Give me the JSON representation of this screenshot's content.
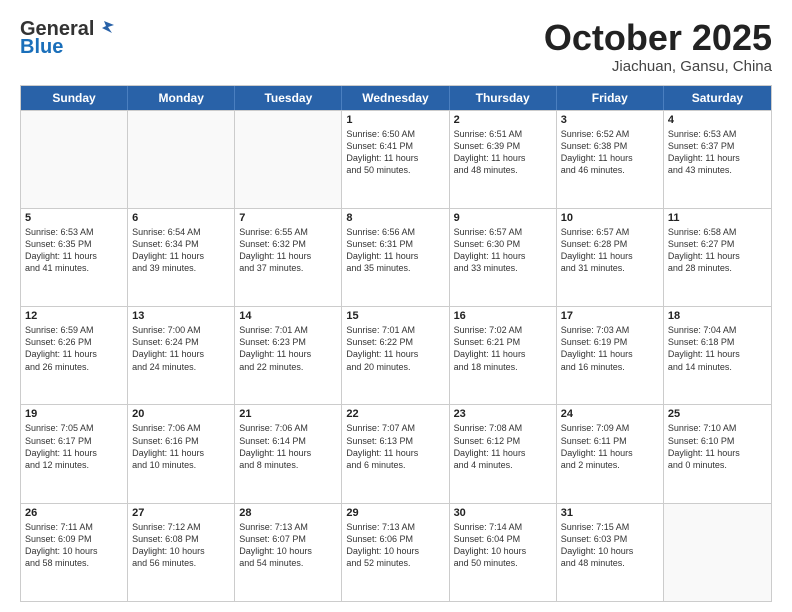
{
  "header": {
    "logo_general": "General",
    "logo_blue": "Blue",
    "month_title": "October 2025",
    "location": "Jiachuan, Gansu, China"
  },
  "weekdays": [
    "Sunday",
    "Monday",
    "Tuesday",
    "Wednesday",
    "Thursday",
    "Friday",
    "Saturday"
  ],
  "weeks": [
    [
      {
        "day": "",
        "info": ""
      },
      {
        "day": "",
        "info": ""
      },
      {
        "day": "",
        "info": ""
      },
      {
        "day": "1",
        "info": "Sunrise: 6:50 AM\nSunset: 6:41 PM\nDaylight: 11 hours\nand 50 minutes."
      },
      {
        "day": "2",
        "info": "Sunrise: 6:51 AM\nSunset: 6:39 PM\nDaylight: 11 hours\nand 48 minutes."
      },
      {
        "day": "3",
        "info": "Sunrise: 6:52 AM\nSunset: 6:38 PM\nDaylight: 11 hours\nand 46 minutes."
      },
      {
        "day": "4",
        "info": "Sunrise: 6:53 AM\nSunset: 6:37 PM\nDaylight: 11 hours\nand 43 minutes."
      }
    ],
    [
      {
        "day": "5",
        "info": "Sunrise: 6:53 AM\nSunset: 6:35 PM\nDaylight: 11 hours\nand 41 minutes."
      },
      {
        "day": "6",
        "info": "Sunrise: 6:54 AM\nSunset: 6:34 PM\nDaylight: 11 hours\nand 39 minutes."
      },
      {
        "day": "7",
        "info": "Sunrise: 6:55 AM\nSunset: 6:32 PM\nDaylight: 11 hours\nand 37 minutes."
      },
      {
        "day": "8",
        "info": "Sunrise: 6:56 AM\nSunset: 6:31 PM\nDaylight: 11 hours\nand 35 minutes."
      },
      {
        "day": "9",
        "info": "Sunrise: 6:57 AM\nSunset: 6:30 PM\nDaylight: 11 hours\nand 33 minutes."
      },
      {
        "day": "10",
        "info": "Sunrise: 6:57 AM\nSunset: 6:28 PM\nDaylight: 11 hours\nand 31 minutes."
      },
      {
        "day": "11",
        "info": "Sunrise: 6:58 AM\nSunset: 6:27 PM\nDaylight: 11 hours\nand 28 minutes."
      }
    ],
    [
      {
        "day": "12",
        "info": "Sunrise: 6:59 AM\nSunset: 6:26 PM\nDaylight: 11 hours\nand 26 minutes."
      },
      {
        "day": "13",
        "info": "Sunrise: 7:00 AM\nSunset: 6:24 PM\nDaylight: 11 hours\nand 24 minutes."
      },
      {
        "day": "14",
        "info": "Sunrise: 7:01 AM\nSunset: 6:23 PM\nDaylight: 11 hours\nand 22 minutes."
      },
      {
        "day": "15",
        "info": "Sunrise: 7:01 AM\nSunset: 6:22 PM\nDaylight: 11 hours\nand 20 minutes."
      },
      {
        "day": "16",
        "info": "Sunrise: 7:02 AM\nSunset: 6:21 PM\nDaylight: 11 hours\nand 18 minutes."
      },
      {
        "day": "17",
        "info": "Sunrise: 7:03 AM\nSunset: 6:19 PM\nDaylight: 11 hours\nand 16 minutes."
      },
      {
        "day": "18",
        "info": "Sunrise: 7:04 AM\nSunset: 6:18 PM\nDaylight: 11 hours\nand 14 minutes."
      }
    ],
    [
      {
        "day": "19",
        "info": "Sunrise: 7:05 AM\nSunset: 6:17 PM\nDaylight: 11 hours\nand 12 minutes."
      },
      {
        "day": "20",
        "info": "Sunrise: 7:06 AM\nSunset: 6:16 PM\nDaylight: 11 hours\nand 10 minutes."
      },
      {
        "day": "21",
        "info": "Sunrise: 7:06 AM\nSunset: 6:14 PM\nDaylight: 11 hours\nand 8 minutes."
      },
      {
        "day": "22",
        "info": "Sunrise: 7:07 AM\nSunset: 6:13 PM\nDaylight: 11 hours\nand 6 minutes."
      },
      {
        "day": "23",
        "info": "Sunrise: 7:08 AM\nSunset: 6:12 PM\nDaylight: 11 hours\nand 4 minutes."
      },
      {
        "day": "24",
        "info": "Sunrise: 7:09 AM\nSunset: 6:11 PM\nDaylight: 11 hours\nand 2 minutes."
      },
      {
        "day": "25",
        "info": "Sunrise: 7:10 AM\nSunset: 6:10 PM\nDaylight: 11 hours\nand 0 minutes."
      }
    ],
    [
      {
        "day": "26",
        "info": "Sunrise: 7:11 AM\nSunset: 6:09 PM\nDaylight: 10 hours\nand 58 minutes."
      },
      {
        "day": "27",
        "info": "Sunrise: 7:12 AM\nSunset: 6:08 PM\nDaylight: 10 hours\nand 56 minutes."
      },
      {
        "day": "28",
        "info": "Sunrise: 7:13 AM\nSunset: 6:07 PM\nDaylight: 10 hours\nand 54 minutes."
      },
      {
        "day": "29",
        "info": "Sunrise: 7:13 AM\nSunset: 6:06 PM\nDaylight: 10 hours\nand 52 minutes."
      },
      {
        "day": "30",
        "info": "Sunrise: 7:14 AM\nSunset: 6:04 PM\nDaylight: 10 hours\nand 50 minutes."
      },
      {
        "day": "31",
        "info": "Sunrise: 7:15 AM\nSunset: 6:03 PM\nDaylight: 10 hours\nand 48 minutes."
      },
      {
        "day": "",
        "info": ""
      }
    ]
  ]
}
